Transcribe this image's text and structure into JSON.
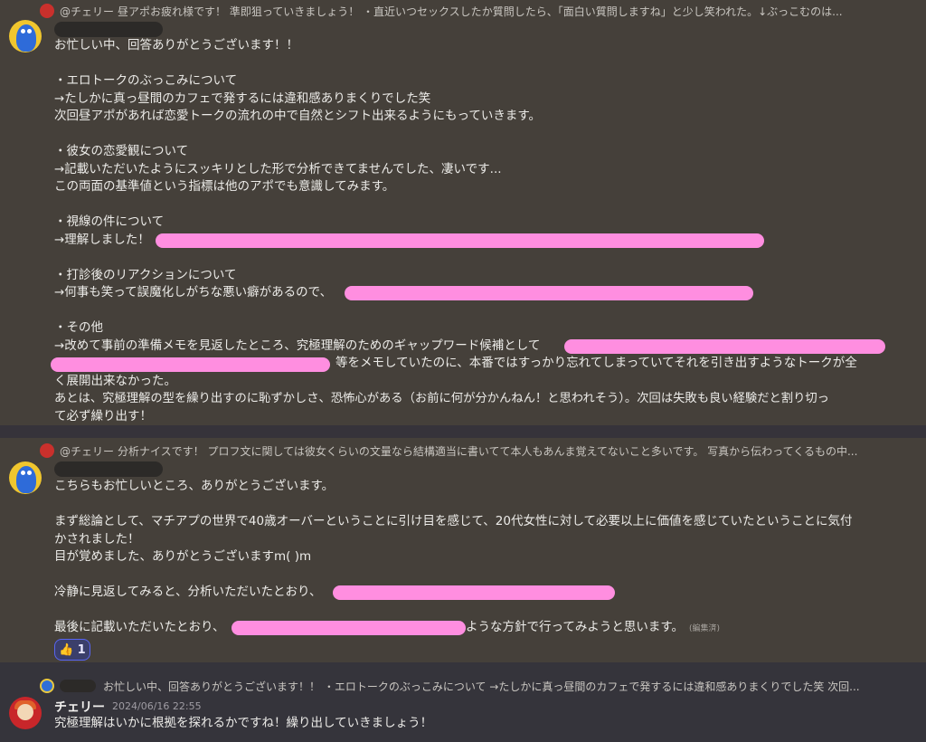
{
  "message1": {
    "reply_mention": "@チェリー",
    "reply_text": "昼アポお疲れ様です！ 準即狙っていきましょう！ ・直近いつセックスしたか質問したら、「面白い質問しますね」と少し笑われた。↓ぶっこむのは...",
    "lines": [
      "お忙しい中、回答ありがとうございます！！",
      "",
      "・エロトークのぶっこみについて",
      "→たしかに真っ昼間のカフェで発するには違和感ありまくりでした笑",
      "次回昼アポがあれば恋愛トークの流れの中で自然とシフト出来るようにもっていきます。",
      "",
      "・彼女の恋愛観について",
      "→記載いただいたようにスッキリとした形で分析できてませんでした、凄いです...",
      "この両面の基準値という指標は他のアポでも意識してみます。",
      "",
      "・視線の件について",
      "→理解しました！",
      "",
      "・打診後のリアクションについて",
      "→何事も笑って誤魔化しがちな悪い癖があるので、",
      "",
      "・その他",
      "→改めて事前の準備メモを見返したところ、究極理解のためのギャップワード候補として",
      "等をメモしていたのに、本番ではすっかり忘れてしまっていてそれを引き出すようなトークが全",
      "く展開出来なかった。",
      "あとは、究極理解の型を繰り出すのに恥ずかしさ、恐怖心がある（お前に何が分かんねん！と思われそう）。次回は失敗も良い経験だと割り切っ",
      "て必ず繰り出す！"
    ]
  },
  "message2": {
    "reply_mention": "@チェリー",
    "reply_text": "分析ナイスです！ プロフ文に関しては彼女くらいの文量なら結構適当に書いてて本人もあんま覚えてないこと多いです。 写真から伝わってくるもの中...",
    "lines": [
      "こちらもお忙しいところ、ありがとうございます。",
      "",
      "まず総論として、マチアプの世界で40歳オーバーということに引け目を感じて、20代女性に対して必要以上に価値を感じていたということに気付",
      "かされました！",
      "目が覚めました、ありがとうございますm( )m",
      "",
      "冷静に見返してみると、分析いただいたとおり、",
      "",
      "最後に記載いただいたとおり、",
      "ような方針で行ってみようと思います。"
    ],
    "edited_label": "(編集済)",
    "reaction_emoji": "👍",
    "reaction_count": "1"
  },
  "message3": {
    "reply_text": "お忙しい中、回答ありがとうございます！！ ・エロトークのぶっこみについて →たしかに真っ昼間のカフェで発するには違和感ありまくりでした笑 次回...",
    "author": "チェリー",
    "timestamp": "2024/06/16 22:55",
    "content": "究極理解はいかに根拠を探れるかですね！繰り出していきましょう！"
  },
  "colors": {
    "accent_highlight": "#ff8ee0",
    "reaction_border": "#5865f2"
  }
}
